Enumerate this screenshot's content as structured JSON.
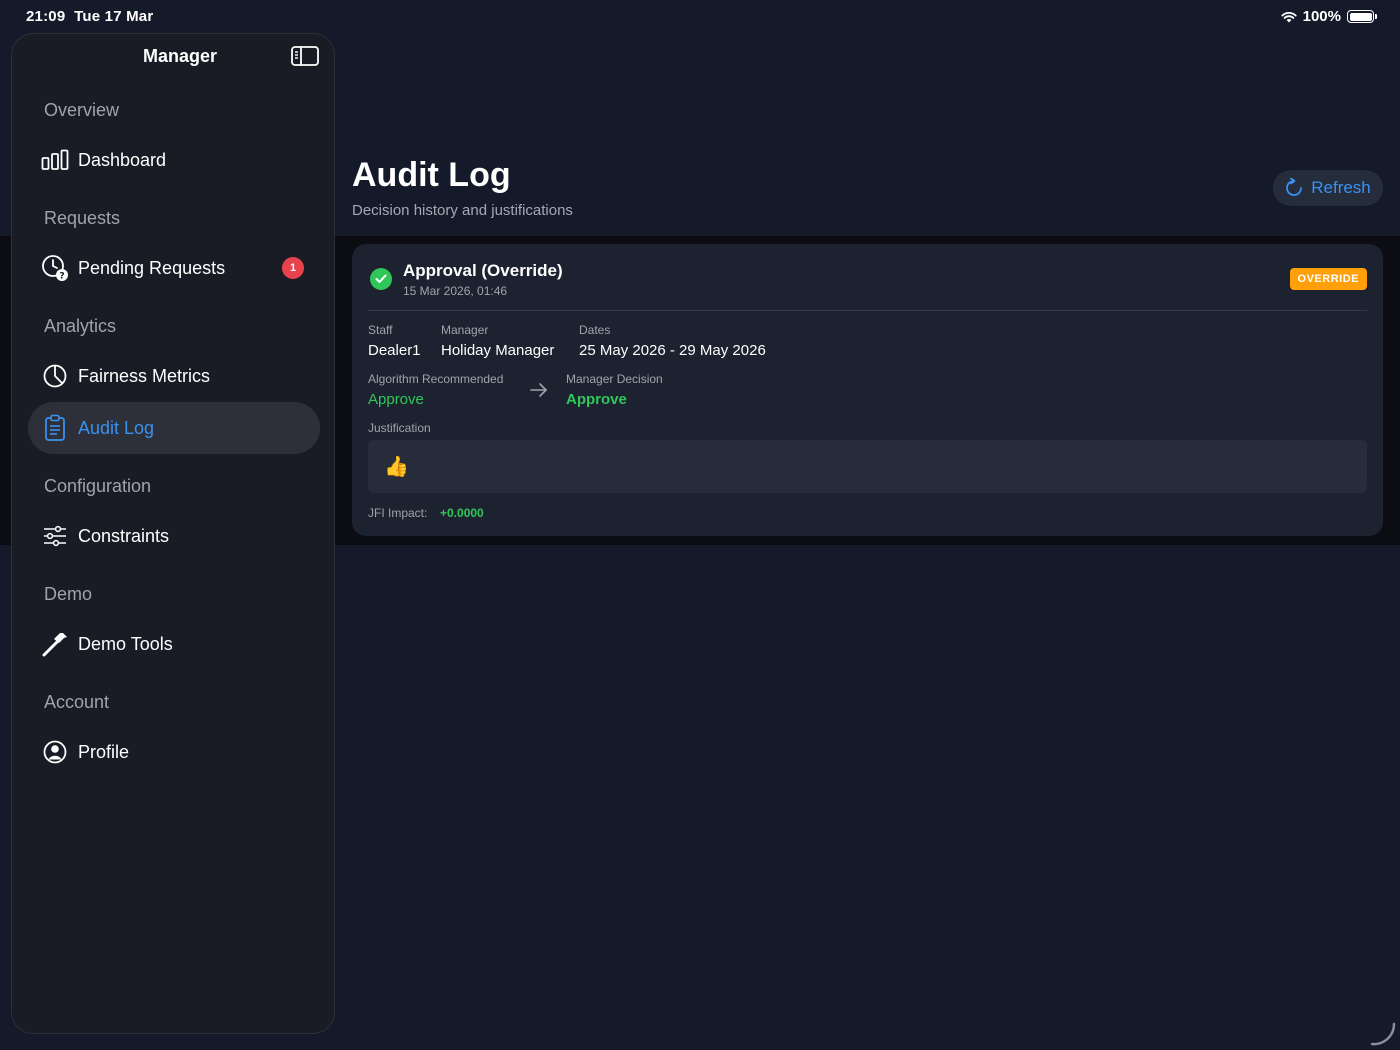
{
  "status_bar": {
    "time": "21:09",
    "date": "Tue 17 Mar",
    "battery": "100%"
  },
  "sidebar": {
    "title": "Manager",
    "sections": {
      "overview": "Overview",
      "requests": "Requests",
      "analytics": "Analytics",
      "configuration": "Configuration",
      "demo": "Demo",
      "account": "Account"
    },
    "items": {
      "dashboard": "Dashboard",
      "pending_requests": "Pending Requests",
      "pending_badge": "1",
      "fairness_metrics": "Fairness Metrics",
      "audit_log": "Audit Log",
      "constraints": "Constraints",
      "demo_tools": "Demo Tools",
      "profile": "Profile"
    }
  },
  "header": {
    "title": "Audit Log",
    "subtitle": "Decision history and justifications",
    "refresh_label": "Refresh"
  },
  "entry": {
    "title": "Approval (Override)",
    "timestamp": "15 Mar 2026, 01:46",
    "badge": "OVERRIDE",
    "staff_label": "Staff",
    "staff_value": "Dealer1",
    "manager_label": "Manager",
    "manager_value": "Holiday Manager",
    "dates_label": "Dates",
    "dates_value": "25 May 2026 - 29 May 2026",
    "algo_label": "Algorithm Recommended",
    "algo_value": "Approve",
    "decision_label": "Manager Decision",
    "decision_value": "Approve",
    "justification_label": "Justification",
    "justification_value": "👍",
    "jfi_label": "JFI Impact:",
    "jfi_value": "+0.0000"
  },
  "colors": {
    "accent": "#3a91f0",
    "success": "#30c75a",
    "warning": "#ff9f0a",
    "danger": "#e8434d"
  }
}
